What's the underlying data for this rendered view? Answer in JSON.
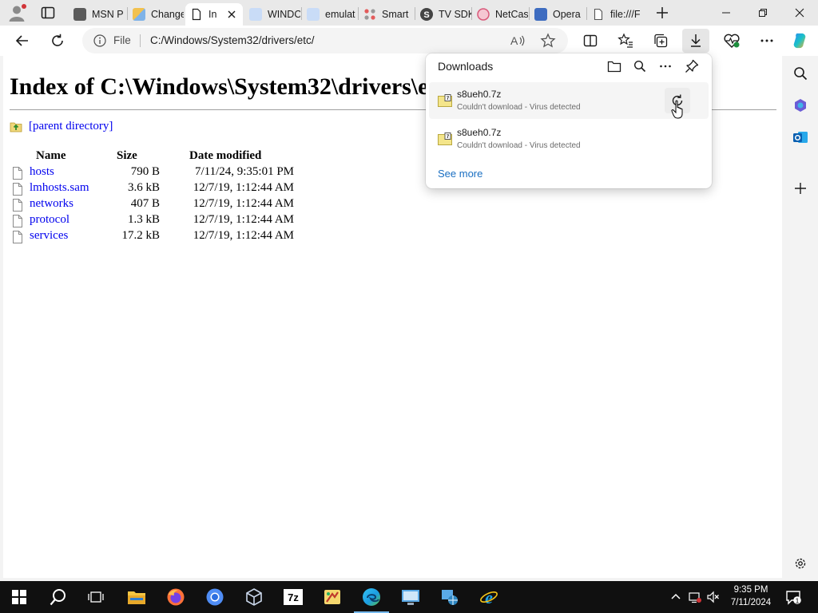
{
  "browser": {
    "tabs": [
      {
        "label": "MSN P",
        "favicon_color": "#5b5b5b"
      },
      {
        "label": "Change",
        "favicon_color": "#f2c14e"
      },
      {
        "label": "In",
        "favicon_color": "#ffffff"
      },
      {
        "label": "WINDO",
        "favicon_color": "#4a86e8"
      },
      {
        "label": "emulat",
        "favicon_color": "#4a86e8"
      },
      {
        "label": "Smart",
        "favicon_color": "#e35b5b"
      },
      {
        "label": "TV SDK",
        "favicon_color": "#444444"
      },
      {
        "label": "NetCas",
        "favicon_color": "#d9597a"
      },
      {
        "label": "Opera",
        "favicon_color": "#3e6cc0"
      },
      {
        "label": "file:///F",
        "favicon_color": "#ffffff"
      }
    ],
    "address": {
      "scheme_label": "File",
      "url": "C:/Windows/System32/drivers/etc/"
    }
  },
  "page": {
    "title": "Index of C:\\Windows\\System32\\drivers\\etc\\",
    "parent_link": "[parent directory]",
    "columns": {
      "name": "Name",
      "size": "Size",
      "date": "Date modified"
    },
    "files": [
      {
        "name": "hosts",
        "size": "790 B",
        "date": "7/11/24, 9:35:01 PM"
      },
      {
        "name": "lmhosts.sam",
        "size": "3.6 kB",
        "date": "12/7/19, 1:12:44 AM"
      },
      {
        "name": "networks",
        "size": "407 B",
        "date": "12/7/19, 1:12:44 AM"
      },
      {
        "name": "protocol",
        "size": "1.3 kB",
        "date": "12/7/19, 1:12:44 AM"
      },
      {
        "name": "services",
        "size": "17.2 kB",
        "date": "12/7/19, 1:12:44 AM"
      }
    ]
  },
  "downloads": {
    "title": "Downloads",
    "items": [
      {
        "name": "s8ueh0.7z",
        "status": "Couldn't download - Virus detected"
      },
      {
        "name": "s8ueh0.7z",
        "status": "Couldn't download - Virus detected"
      }
    ],
    "see_more": "See more"
  },
  "taskbar": {
    "time": "9:35 PM",
    "date": "7/11/2024",
    "notification_count": "1",
    "accent": "#76b9ed"
  }
}
